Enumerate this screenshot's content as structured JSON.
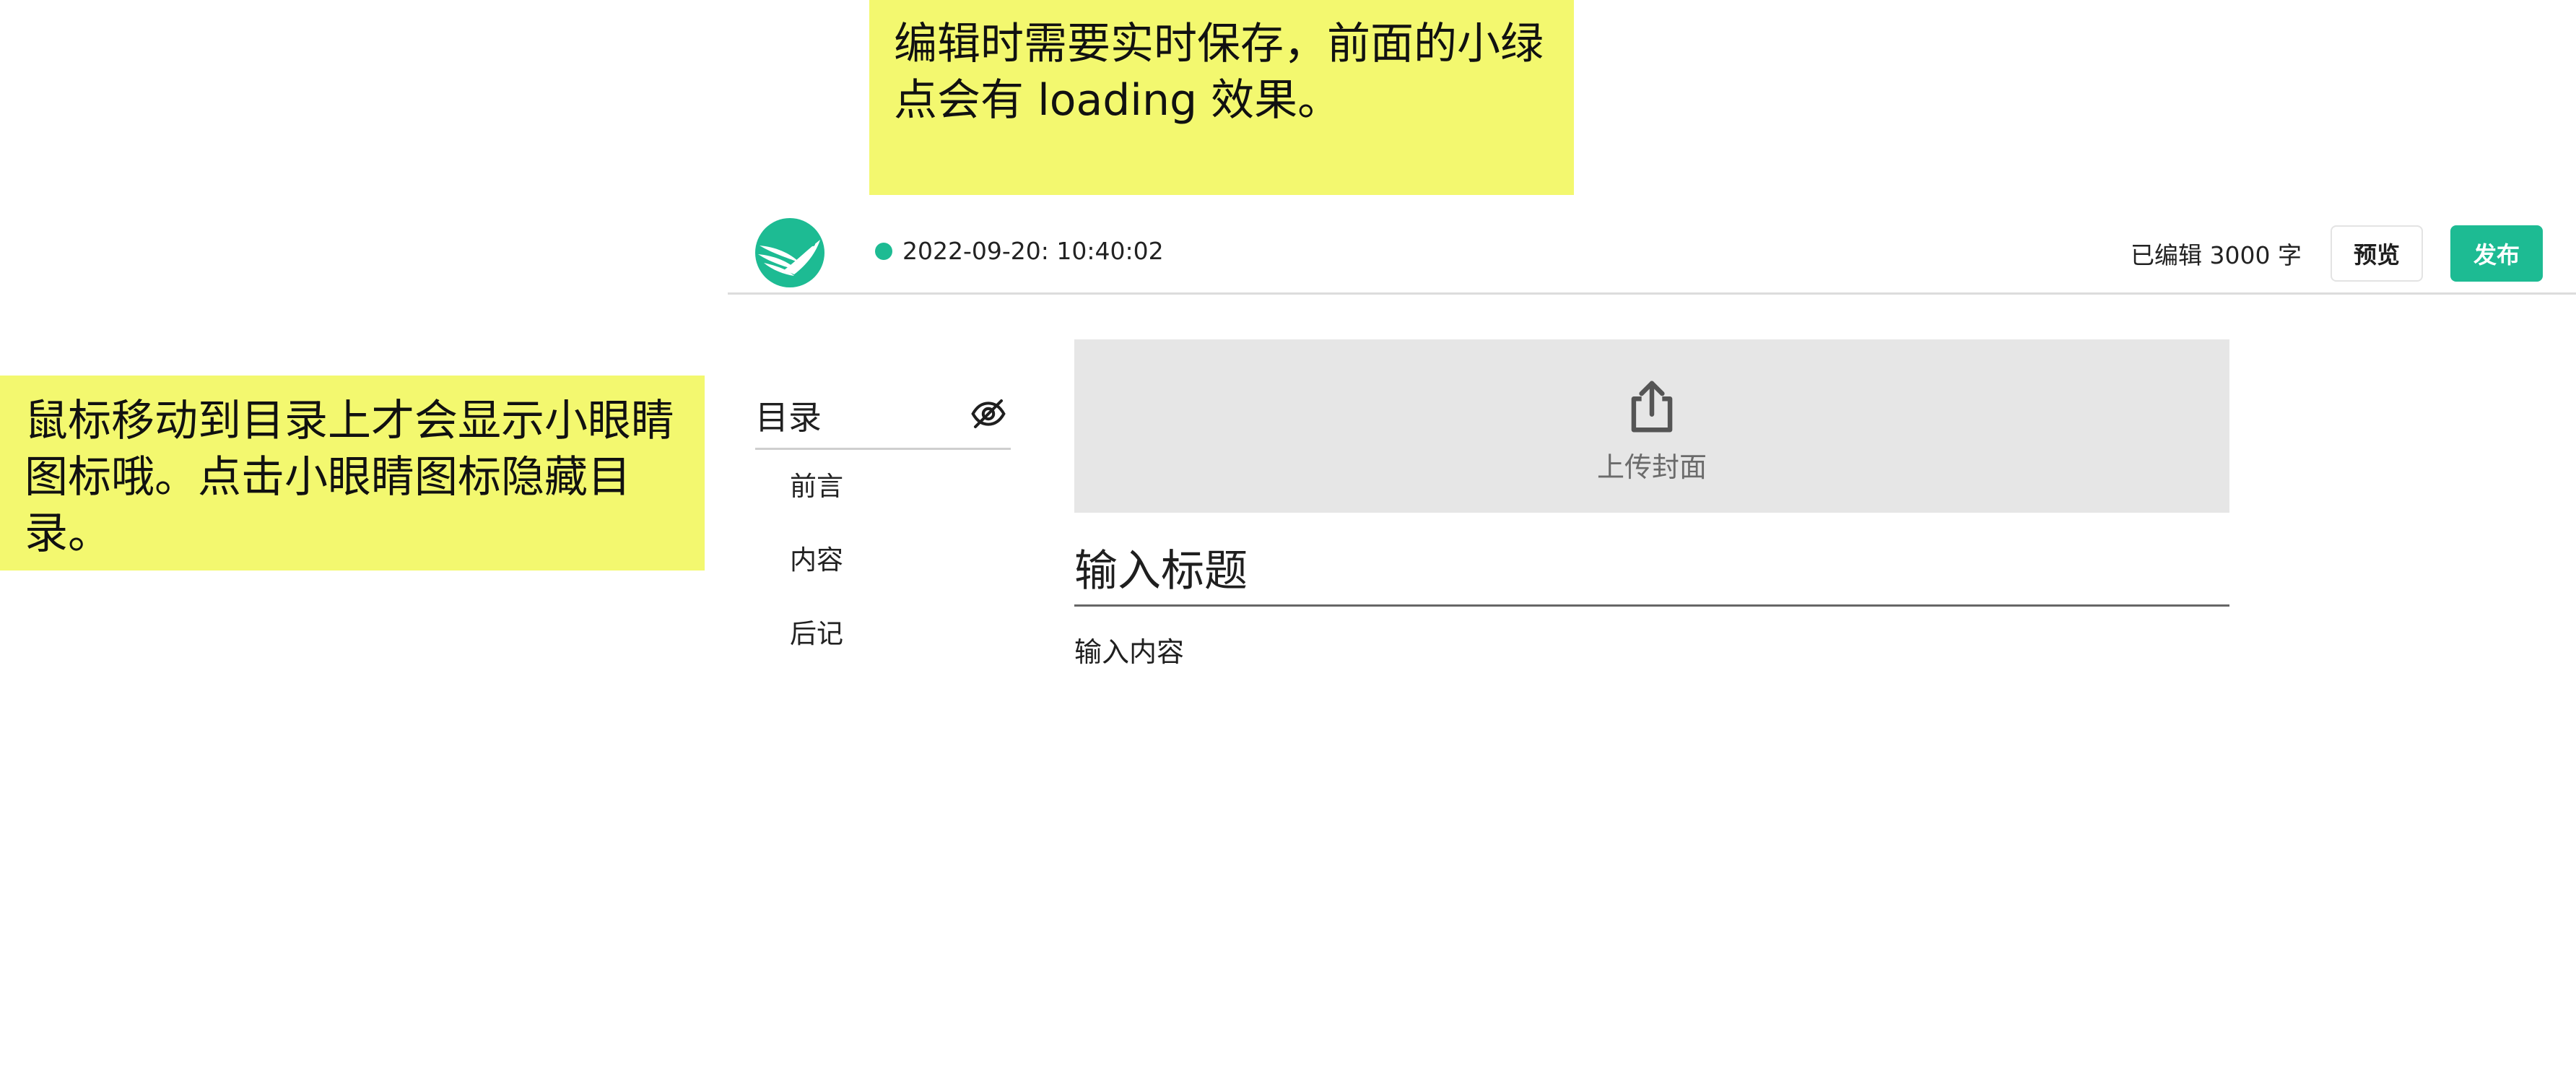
{
  "notes": {
    "top": "编辑时需要实时保存，前面的小绿点会有 loading 效果。",
    "left": "鼠标移动到目录上才会显示小眼睛图标哦。点击小眼睛图标隐藏目录。"
  },
  "header": {
    "save_time": "2022-09-20: 10:40:02",
    "word_count": "已编辑 3000 字",
    "preview_label": "预览",
    "publish_label": "发布"
  },
  "toc": {
    "title": "目录",
    "items": [
      {
        "label": "前言"
      },
      {
        "label": "内容"
      },
      {
        "label": "后记"
      }
    ]
  },
  "editor": {
    "cover_label": "上传封面",
    "title_placeholder": "输入标题",
    "content_placeholder": "输入内容"
  },
  "colors": {
    "accent": "#1dbb93",
    "note": "#f3f86f"
  },
  "icons": {
    "logo": "bird-logo-icon",
    "toc_toggle": "eye-off-icon",
    "cover_upload": "upload-icon"
  }
}
